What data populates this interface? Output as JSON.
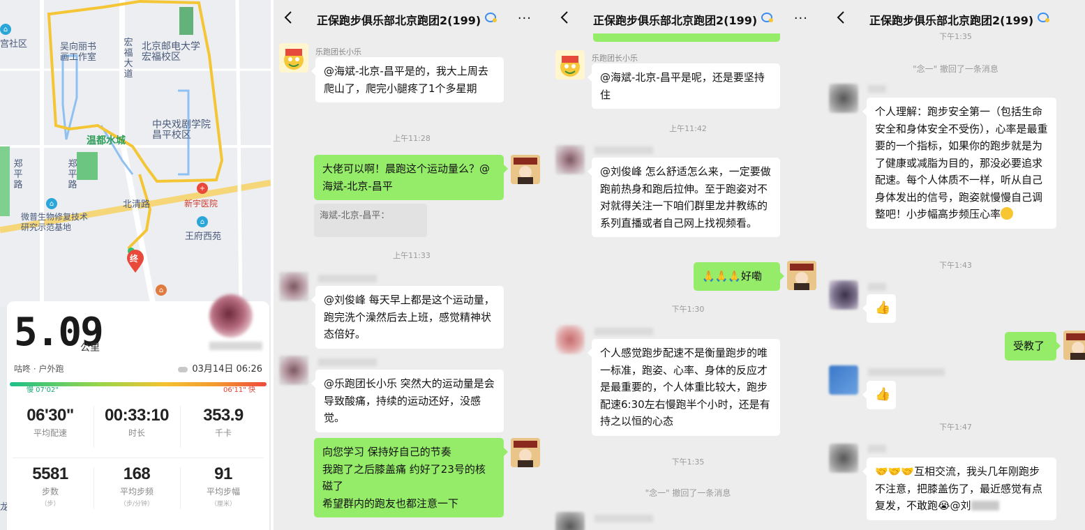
{
  "map": {
    "labels": {
      "community": "宫社区",
      "studio": "吴向丽书画工作室",
      "honglin_road": "宏福大道",
      "bupt": "北京邮电大学宏福校区",
      "central_drama": "中央戏剧学院昌平校区",
      "wendu": "温都水城",
      "zheng_ping": "郑平路",
      "zheng_ping2": "郑平路",
      "beiqing": "北清路",
      "microbio": "微普生物修复技术研究示范基地",
      "xinyu": "新宇医院",
      "wangfu": "王府西苑",
      "end_marker": "终",
      "left_edge": "龙"
    },
    "colors": {
      "route": "#f4c534",
      "start": "#2fbf71",
      "end": "#e8493b",
      "park": "#5bbf74",
      "water": "#9cc6f0"
    }
  },
  "run": {
    "distance": "5.09",
    "distance_unit": "公里",
    "sport": "咕咚 · 户外跑",
    "date": "03月14日 06:26",
    "pace_slow": "慢 07'02\"",
    "pace_fast": "06'11\" 快",
    "stats": [
      {
        "value": "06'30\"",
        "label": "平均配速",
        "unit": ""
      },
      {
        "value": "00:33:10",
        "label": "时长",
        "unit": ""
      },
      {
        "value": "353.9",
        "label": "千卡",
        "unit": ""
      },
      {
        "value": "5581",
        "label": "步数",
        "unit": "（步）"
      },
      {
        "value": "168",
        "label": "平均步频",
        "unit": "（步/分钟）"
      },
      {
        "value": "91",
        "label": "平均步幅",
        "unit": "（厘米）"
      }
    ]
  },
  "chats": [
    {
      "title": "正保跑步俱乐部北京跑团2(199)",
      "more": "···",
      "messages": [
        {
          "sender": "乐跑团长小乐",
          "text": "@海斌-北京-昌平是的，我大上周去爬山了，爬完小腿疼了1个多星期"
        },
        {
          "time": "上午11:28"
        },
        {
          "text": "大佬可以啊！晨跑这个运动量么？@海斌-北京-昌平"
        },
        {
          "quote": "海斌-北京-昌平："
        },
        {
          "time": "上午11:33"
        },
        {
          "text": "@刘俊峰  每天早上都是这个运动量，跑完洗个澡然后去上班，感觉精神状态倍好。"
        },
        {
          "text": "@乐跑团长小乐  突然大的运动量是会导致酸痛，持续的运动还好，没感觉。"
        },
        {
          "text": "向您学习  保持好自己的节奏\n我跑了之后膝盖痛  约好了23号的核磁了\n希望群内的跑友也都注意一下"
        }
      ]
    },
    {
      "title": "正保跑步俱乐部北京跑团2(199)",
      "more": "···",
      "messages": [
        {
          "sender": "乐跑团长小乐",
          "text": "@海斌-北京-昌平是呢，还是要坚持住"
        },
        {
          "time": "上午11:42"
        },
        {
          "text": "@刘俊峰  怎么舒适怎么来，一定要做跑前热身和跑后拉伸。至于跑姿对不对就得关注一下咱们群里龙井教练的系列直播或者自己网上找视频看。"
        },
        {
          "text": "🙏🙏🙏好嘞"
        },
        {
          "time": "下午1:30"
        },
        {
          "text": "个人感觉跑步配速不是衡量跑步的唯一标准，跑姿、心率、身体的反应才是最重要的，个人体重比较大，跑步配速6:30左右慢跑半个小时，还是有持之以恒的心态"
        },
        {
          "time": "下午1:35"
        },
        {
          "sys": "\"念一\" 撤回了一条消息"
        }
      ]
    },
    {
      "title": "正保跑步俱乐部北京跑团2(199)",
      "more": "···",
      "messages": [
        {
          "time": "下午1:35"
        },
        {
          "sys": "\"念一\" 撤回了一条消息"
        },
        {
          "text": "个人理解：跑步安全第一（包括生命安全和身体安全不受伤），心率是最重要的一个指标，如果你的跑步就是为了健康或减脂为目的，那没必要追求配速。每个人体质不一样，听从自己身体发出的信号，跑姿就慢慢自己调整吧！小步幅高步频压心率"
        },
        {
          "time": "下午1:43"
        },
        {
          "text": "👍"
        },
        {
          "text": "受教了"
        },
        {
          "text": "👍"
        },
        {
          "time": "下午1:47"
        },
        {
          "text": "🤝🤝🤝互相交流，我头几年刚跑步不注意，把膝盖伤了，最近感觉有点复发，不敢跑😭@刘"
        }
      ]
    }
  ]
}
